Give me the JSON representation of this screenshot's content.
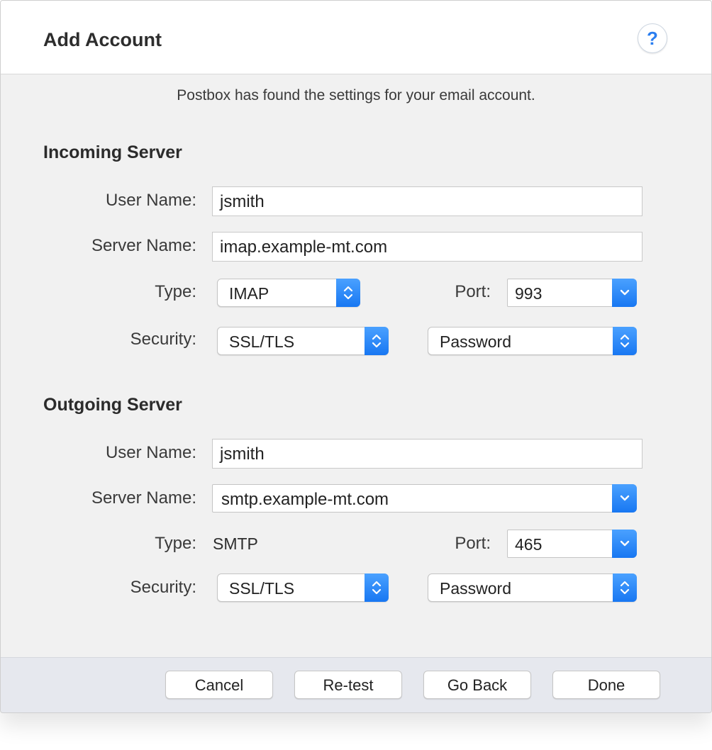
{
  "dialog": {
    "title": "Add Account",
    "help_icon": "question-mark-icon",
    "help_label": "?",
    "subtitle": "Postbox has found the settings for your email account."
  },
  "incoming": {
    "section_title": "Incoming Server",
    "user_name_label": "User Name:",
    "user_name_value": "jsmith",
    "server_name_label": "Server Name:",
    "server_name_value": "imap.example-mt.com",
    "type_label": "Type:",
    "type_value": "IMAP",
    "port_label": "Port:",
    "port_value": "993",
    "security_label": "Security:",
    "security_value": "SSL/TLS",
    "auth_value": "Password"
  },
  "outgoing": {
    "section_title": "Outgoing Server",
    "user_name_label": "User Name:",
    "user_name_value": "jsmith",
    "server_name_label": "Server Name:",
    "server_name_value": "smtp.example-mt.com",
    "type_label": "Type:",
    "type_value": "SMTP",
    "port_label": "Port:",
    "port_value": "465",
    "security_label": "Security:",
    "security_value": "SSL/TLS",
    "auth_value": "Password"
  },
  "footer": {
    "cancel": "Cancel",
    "retest": "Re-test",
    "go_back": "Go Back",
    "done": "Done"
  },
  "colors": {
    "accent": "#1877f2",
    "window_bg": "#f1f1f1",
    "footer_bg": "#e6e8ee"
  }
}
